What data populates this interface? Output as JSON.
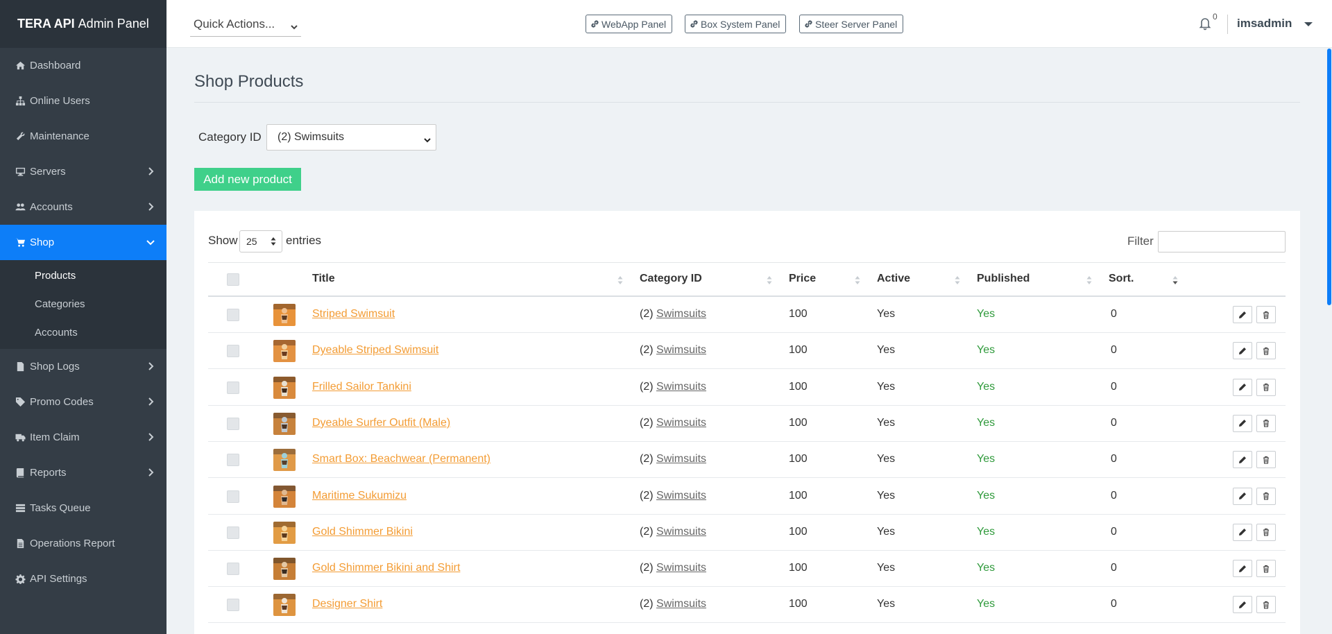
{
  "brand": {
    "bold": "TERA API",
    "rest": "Admin Panel"
  },
  "topbar": {
    "quick_actions": "Quick Actions...",
    "panels": [
      "WebApp Panel",
      "Box System Panel",
      "Steer Server Panel"
    ],
    "notifications": "0",
    "user": "imsadmin"
  },
  "sidebar": {
    "items": [
      {
        "label": "Dashboard",
        "icon": "home-icon"
      },
      {
        "label": "Online Users",
        "icon": "sitemap-icon"
      },
      {
        "label": "Maintenance",
        "icon": "wrench-icon"
      },
      {
        "label": "Servers",
        "icon": "desktop-icon"
      },
      {
        "label": "Accounts",
        "icon": "users-icon"
      },
      {
        "label": "Shop",
        "icon": "cart-icon"
      },
      {
        "label": "Shop Logs",
        "icon": "file-icon"
      },
      {
        "label": "Promo Codes",
        "icon": "tag-icon"
      },
      {
        "label": "Item Claim",
        "icon": "truck-icon"
      },
      {
        "label": "Reports",
        "icon": "book-icon"
      },
      {
        "label": "Tasks Queue",
        "icon": "tasks-icon"
      },
      {
        "label": "Operations Report",
        "icon": "document-icon"
      },
      {
        "label": "API Settings",
        "icon": "gear-icon"
      }
    ],
    "shop_submenu": [
      "Products",
      "Categories",
      "Accounts"
    ]
  },
  "main": {
    "title": "Shop Products",
    "category_label": "Category ID",
    "category_value": "(2) Swimsuits",
    "add_button": "Add new product",
    "show_label": "Show",
    "page_size": "25",
    "entries_label": "entries",
    "filter_label": "Filter",
    "columns": [
      "Title",
      "Category ID",
      "Price",
      "Active",
      "Published",
      "Sort."
    ],
    "rows": [
      {
        "title": "Striped Swimsuit",
        "cat_num": "(2)",
        "cat_name": "Swimsuits",
        "price": "100",
        "active": "Yes",
        "published": "Yes",
        "sort": "0"
      },
      {
        "title": "Dyeable Striped Swimsuit",
        "cat_num": "(2)",
        "cat_name": "Swimsuits",
        "price": "100",
        "active": "Yes",
        "published": "Yes",
        "sort": "0"
      },
      {
        "title": "Frilled Sailor Tankini",
        "cat_num": "(2)",
        "cat_name": "Swimsuits",
        "price": "100",
        "active": "Yes",
        "published": "Yes",
        "sort": "0"
      },
      {
        "title": "Dyeable Surfer Outfit (Male)",
        "cat_num": "(2)",
        "cat_name": "Swimsuits",
        "price": "100",
        "active": "Yes",
        "published": "Yes",
        "sort": "0"
      },
      {
        "title": "Smart Box: Beachwear (Permanent)",
        "cat_num": "(2)",
        "cat_name": "Swimsuits",
        "price": "100",
        "active": "Yes",
        "published": "Yes",
        "sort": "0"
      },
      {
        "title": "Maritime Sukumizu",
        "cat_num": "(2)",
        "cat_name": "Swimsuits",
        "price": "100",
        "active": "Yes",
        "published": "Yes",
        "sort": "0"
      },
      {
        "title": "Gold Shimmer Bikini",
        "cat_num": "(2)",
        "cat_name": "Swimsuits",
        "price": "100",
        "active": "Yes",
        "published": "Yes",
        "sort": "0"
      },
      {
        "title": "Gold Shimmer Bikini and Shirt",
        "cat_num": "(2)",
        "cat_name": "Swimsuits",
        "price": "100",
        "active": "Yes",
        "published": "Yes",
        "sort": "0"
      },
      {
        "title": "Designer Shirt",
        "cat_num": "(2)",
        "cat_name": "Swimsuits",
        "price": "100",
        "active": "Yes",
        "published": "Yes",
        "sort": "0"
      }
    ]
  },
  "colors": {
    "sidebar_bg": "#343d46",
    "active_bg": "#0d7ef8",
    "add_button": "#3fd08a",
    "link": "#f39c34",
    "published": "#2f9a3b"
  }
}
